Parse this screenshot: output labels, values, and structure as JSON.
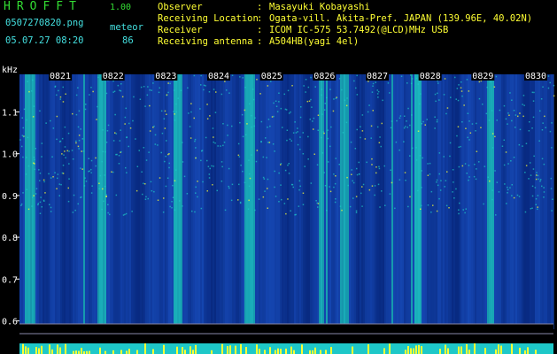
{
  "header": {
    "app_title": "HROFFT",
    "app_version": "1.00",
    "file_name": "0507270820.png",
    "event_label": "meteor",
    "datetime": "05.07.27 08:20",
    "meteor_count": "86"
  },
  "station_info": [
    {
      "key": "Observer",
      "sep": ":",
      "value": "Masayuki Kobayashi"
    },
    {
      "key": "Receiving Location",
      "sep": ":",
      "value": "Ogata-vill. Akita-Pref. JAPAN (139.96E, 40.02N)"
    },
    {
      "key": "Receiver",
      "sep": ":",
      "value": "ICOM IC-575 53.7492(@LCD)MHz USB"
    },
    {
      "key": "Receiving antenna",
      "sep": ":",
      "value": "A504HB(yagi 4el)"
    }
  ],
  "colors": {
    "background": "#000000",
    "spectrum_low": "#001a66",
    "spectrum_mid": "#1e5ad2",
    "spectrum_high": "#1ec8c8",
    "spectrum_peak": "#ffff33",
    "text": "#ffffff",
    "accent": "#ffff33"
  },
  "chart_data": {
    "type": "heatmap",
    "title": "",
    "xlabel": "",
    "ylabel": "kHz",
    "y_ticks": [
      "1.1",
      "1.0",
      "0.9",
      "0.8",
      "0.7",
      "0.6"
    ],
    "ylim": [
      0.58,
      1.19
    ],
    "x_ticks": [
      "0821",
      "0822",
      "0823",
      "0824",
      "0825",
      "0826",
      "0827",
      "0828",
      "0829",
      "0830"
    ],
    "grid": false,
    "colormap": "blue-cyan-yellow"
  }
}
